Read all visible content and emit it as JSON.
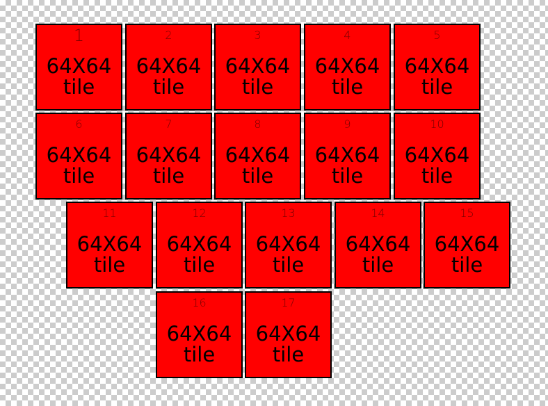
{
  "tiles": [
    {
      "number": "1",
      "size_label": "64X64",
      "word": "tile"
    },
    {
      "number": "2",
      "size_label": "64X64",
      "word": "tile"
    },
    {
      "number": "3",
      "size_label": "64X64",
      "word": "tile"
    },
    {
      "number": "4",
      "size_label": "64X64",
      "word": "tile"
    },
    {
      "number": "5",
      "size_label": "64X64",
      "word": "tile"
    },
    {
      "number": "6",
      "size_label": "64X64",
      "word": "tile"
    },
    {
      "number": "7",
      "size_label": "64X64",
      "word": "tile"
    },
    {
      "number": "8",
      "size_label": "64X64",
      "word": "tile"
    },
    {
      "number": "9",
      "size_label": "64X64",
      "word": "tile"
    },
    {
      "number": "10",
      "size_label": "64X64",
      "word": "tile"
    },
    {
      "number": "11",
      "size_label": "64X64",
      "word": "tile"
    },
    {
      "number": "12",
      "size_label": "64X64",
      "word": "tile"
    },
    {
      "number": "13",
      "size_label": "64X64",
      "word": "tile"
    },
    {
      "number": "14",
      "size_label": "64X64",
      "word": "tile"
    },
    {
      "number": "15",
      "size_label": "64X64",
      "word": "tile"
    },
    {
      "number": "16",
      "size_label": "64X64",
      "word": "tile"
    },
    {
      "number": "17",
      "size_label": "64X64",
      "word": "tile"
    }
  ],
  "colors": {
    "tile_fill": "#ff0000",
    "tile_border": "#000000",
    "background": "transparent-checkerboard"
  }
}
